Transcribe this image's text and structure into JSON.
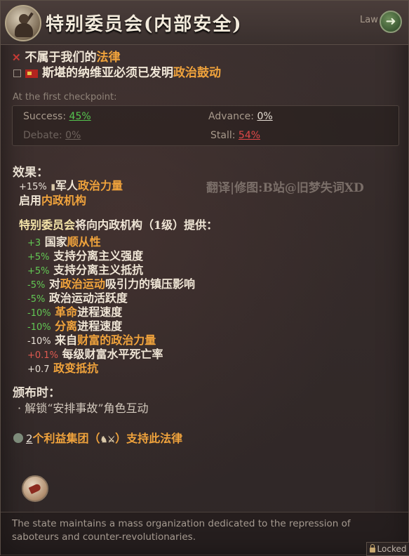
{
  "header": {
    "title": "特别委员会(内部安全)",
    "law_label": "Law",
    "law_button_icon": "arrow-right-icon"
  },
  "requirements": [
    {
      "prefix": "不属于我们的",
      "highlight": "法律"
    },
    {
      "prefix": "斯堪的纳维亚必须已发明",
      "highlight": "政治鼓动"
    }
  ],
  "checkpoint": {
    "label": "At the first checkpoint:",
    "success_label": "Success:",
    "success_value": "45%",
    "advance_label": "Advance:",
    "advance_value": "0%",
    "debate_label": "Debate:",
    "debate_value": "0%",
    "stall_label": "Stall:",
    "stall_value": "54%"
  },
  "watermark": "翻译|修图:B站@旧梦失词XD",
  "effects": {
    "heading": "效果：",
    "line1_num": "+15%",
    "line1_a": "军人",
    "line1_b": "政治力量",
    "line2_a": "启用",
    "line2_b": "内政机构"
  },
  "provides": {
    "heading_a": "特别委员会",
    "heading_b": "将向内政机构（1级）提供：",
    "items": [
      {
        "num": "+3",
        "pre": "国家",
        "hl": "顺从性",
        "post": "",
        "color": "g"
      },
      {
        "num": "+5%",
        "pre": "支持分离主义强度",
        "hl": "",
        "post": "",
        "color": "g"
      },
      {
        "num": "+5%",
        "pre": "支持分离主义抵抗",
        "hl": "",
        "post": "",
        "color": "g"
      },
      {
        "num": "-5%",
        "pre": "对",
        "hl": "政治运动",
        "post": "吸引力的镇压影响",
        "color": "g"
      },
      {
        "num": "-5%",
        "pre": "政治运动活跃度",
        "hl": "",
        "post": "",
        "color": "g"
      },
      {
        "num": "-10%",
        "pre": "",
        "hl": "革命",
        "post": "进程速度",
        "color": "g"
      },
      {
        "num": "-10%",
        "pre": "",
        "hl": "分离",
        "post": "进程速度",
        "color": "g"
      },
      {
        "num": "-10%",
        "pre": "来自",
        "hl": "财富的政治力量",
        "post": "",
        "color": "w"
      },
      {
        "num": "+0.1%",
        "pre": "每级财富水平死亡率",
        "hl": "",
        "post": "",
        "color": "r"
      },
      {
        "num": "+0.7",
        "pre": "",
        "hl": "政变抵抗",
        "post": "",
        "color": "w"
      }
    ]
  },
  "on_enact": {
    "heading": "颁布时：",
    "bullet": "解锁“安排事故”角色互动"
  },
  "support": {
    "count": "2",
    "text_a": "个利益集团（",
    "text_b": "）支持此法律"
  },
  "description": "The state maintains a mass organization dedicated to the repression of saboteurs and counter-revolutionaries.",
  "locked_label": "Locked",
  "colors": {
    "positive": "#62c854",
    "negative": "#e05a50",
    "highlight": "#f0a33c"
  }
}
